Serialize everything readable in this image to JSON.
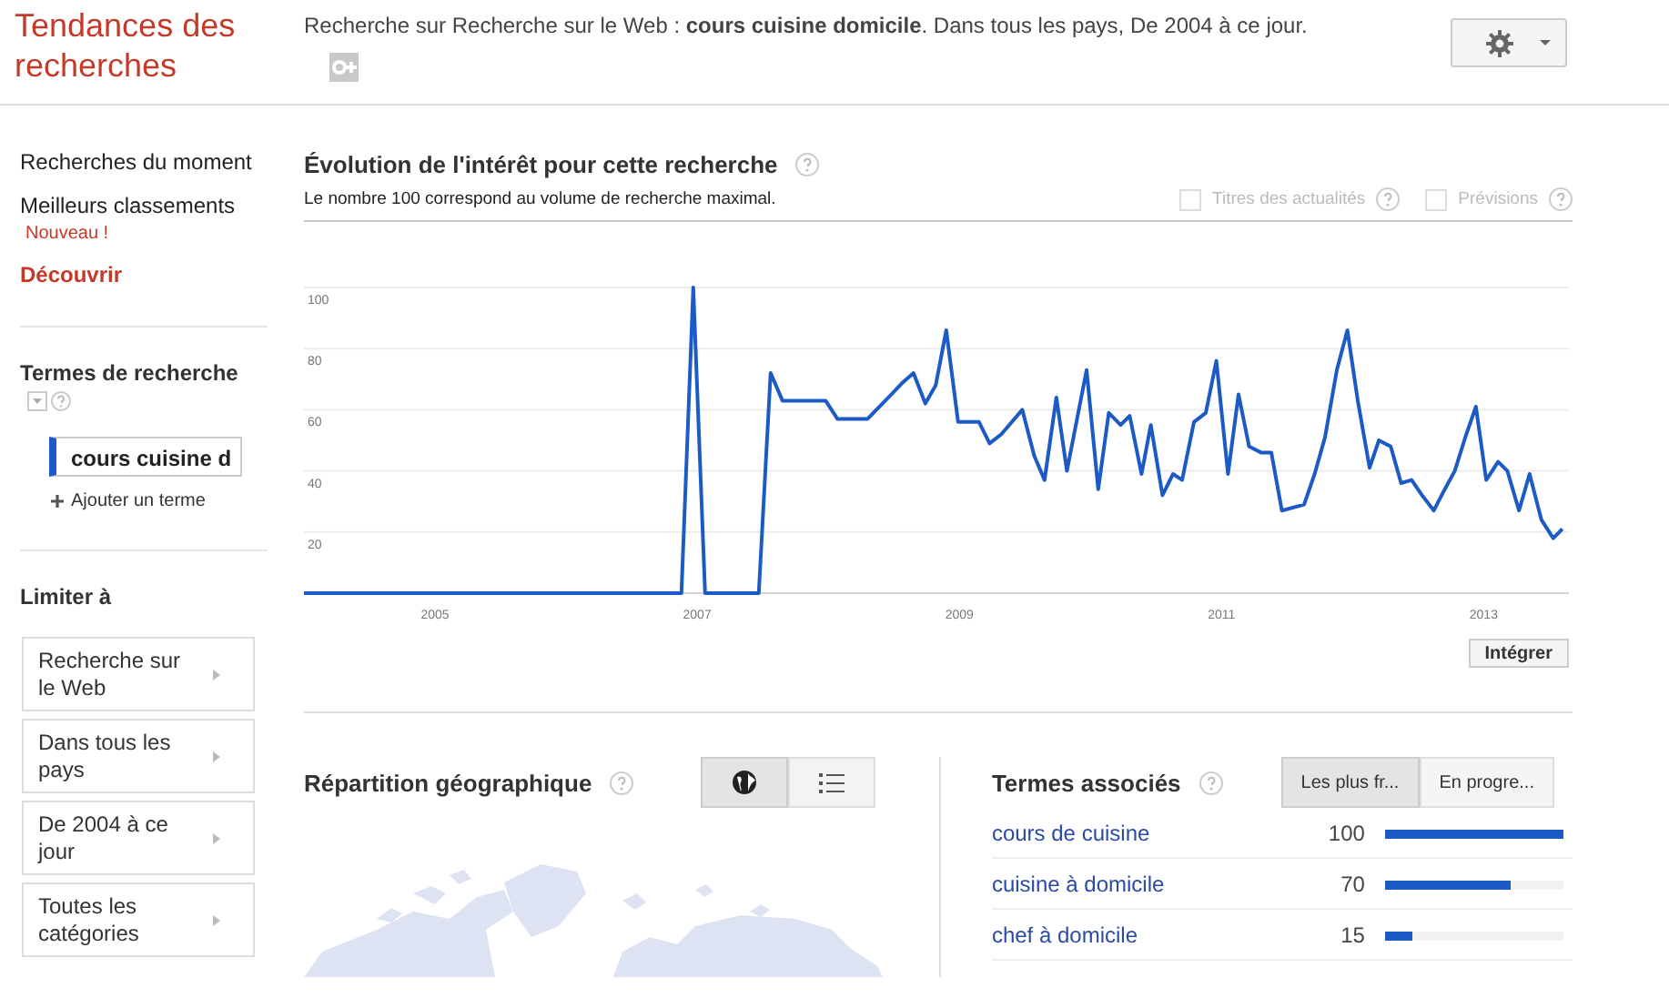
{
  "header": {
    "title": "Tendances des recherches",
    "summary": "Recherche sur Recherche sur le Web : **cours cuisine domicile**. Dans tous les pays, De 2004 à ce jour."
  },
  "sidebar": {
    "nav": [
      {
        "label": "Recherches du moment",
        "selected": false
      },
      {
        "label": "Meilleurs classements",
        "badge": "Nouveau !",
        "selected": false
      },
      {
        "label": "Découvrir",
        "selected": true
      }
    ],
    "terms_title": "Termes de recherche",
    "terms": [
      {
        "value": "cours cuisine d",
        "color": "#1c5bc6"
      }
    ],
    "add_term": "Ajouter un terme",
    "limit_title": "Limiter à",
    "filters": [
      "Recherche sur le Web",
      "Dans tous les pays",
      "De 2004 à ce jour",
      "Toutes les catégories"
    ]
  },
  "interest": {
    "title": "Évolution de l'intérêt pour cette recherche",
    "subtitle": "Le nombre 100 correspond au volume de recherche maximal.",
    "options": [
      {
        "label": "Titres des actualités",
        "checked": false
      },
      {
        "label": "Prévisions",
        "checked": false
      }
    ],
    "chart_data": {
      "type": "line",
      "x": [
        2004,
        2006.88,
        2006.97,
        2007.06,
        2007.47,
        2007.56,
        2007.65,
        2007.98,
        2008.07,
        2008.3,
        2008.48,
        2008.57,
        2008.65,
        2008.74,
        2008.82,
        2008.9,
        2008.99,
        2009.15,
        2009.23,
        2009.32,
        2009.48,
        2009.57,
        2009.65,
        2009.74,
        2009.82,
        2009.97,
        2010.06,
        2010.14,
        2010.23,
        2010.3,
        2010.39,
        2010.46,
        2010.55,
        2010.63,
        2010.7,
        2010.79,
        2010.88,
        2010.96,
        2011.05,
        2011.13,
        2011.21,
        2011.3,
        2011.38,
        2011.46,
        2011.63,
        2011.71,
        2011.79,
        2011.88,
        2011.96,
        2012.04,
        2012.13,
        2012.2,
        2012.29,
        2012.37,
        2012.45,
        2012.53,
        2012.62,
        2012.69,
        2012.78,
        2012.86,
        2012.94,
        2013.02,
        2013.11,
        2013.18,
        2013.27,
        2013.35,
        2013.44,
        2013.53,
        2013.6
      ],
      "series": [
        {
          "color": "#1c5bc6",
          "values": [
            0,
            0,
            100,
            0,
            0,
            72,
            63,
            63,
            57,
            57,
            65,
            69,
            72,
            62,
            68,
            86,
            56,
            56,
            49,
            52,
            60,
            45,
            37,
            64,
            40,
            73,
            34,
            59,
            55,
            58,
            39,
            55,
            32,
            39,
            37,
            56,
            59,
            76,
            39,
            65,
            48,
            46,
            46,
            27,
            29,
            39,
            51,
            73,
            86,
            63,
            41,
            50,
            48,
            36,
            37,
            32,
            27,
            33,
            40,
            51,
            61,
            37,
            43,
            40,
            27,
            39,
            24,
            18,
            21
          ]
        }
      ],
      "xlim": [
        2004,
        2013.65
      ],
      "ylim": [
        0,
        100
      ],
      "xticks": [
        2005,
        2007,
        2009,
        2011,
        2013
      ],
      "yticks": [
        20,
        40,
        60,
        80,
        100
      ],
      "grid": true
    },
    "embed": "Intégrer"
  },
  "geo": {
    "title": "Répartition géographique",
    "views": [
      {
        "kind": "map",
        "selected": true
      },
      {
        "kind": "list",
        "selected": false
      }
    ]
  },
  "related": {
    "title": "Termes associés",
    "tabs": [
      {
        "label": "Les plus fr...",
        "selected": true
      },
      {
        "label": "En progre...",
        "selected": false
      }
    ],
    "rows": [
      {
        "term": "cours de cuisine",
        "value": "100",
        "level": 1
      },
      {
        "term": "cuisine à domicile",
        "value": "70",
        "level": 0.7
      },
      {
        "term": "chef à domicile",
        "value": "15",
        "level": 0.15
      }
    ]
  }
}
